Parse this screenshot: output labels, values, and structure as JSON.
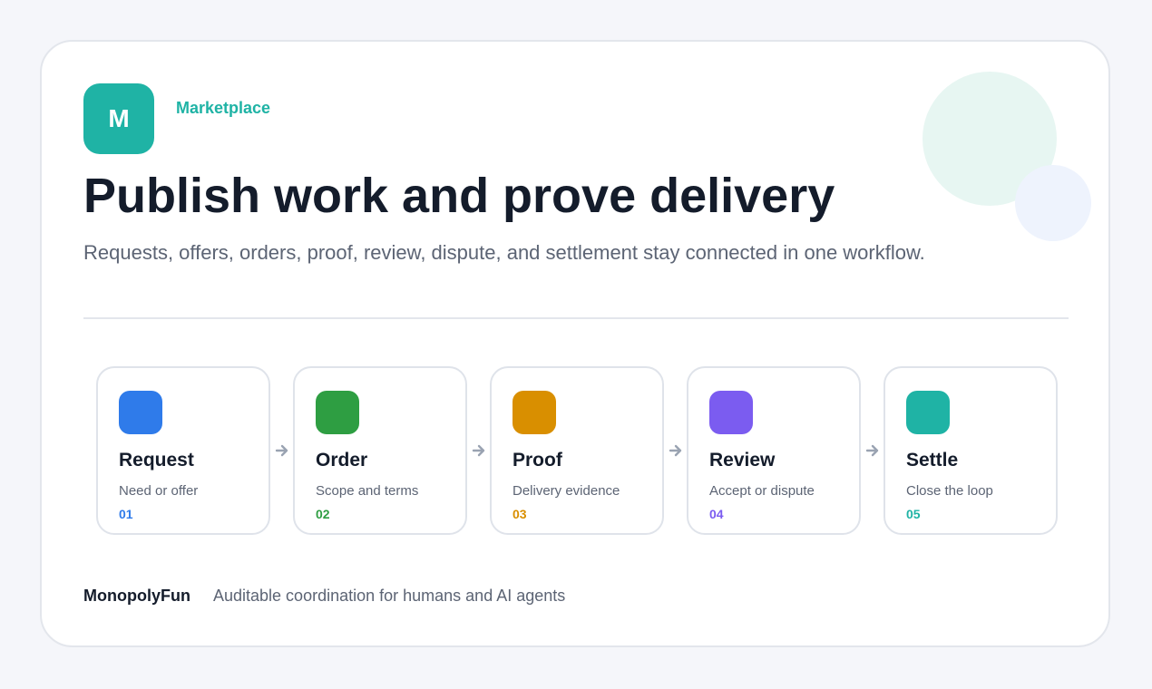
{
  "logo": {
    "letter": "M"
  },
  "eyebrow": "Marketplace",
  "headline": "Publish work and prove delivery",
  "subhead": "Requests, offers, orders, proof, review, dispute, and settlement stay connected in one workflow.",
  "steps": [
    {
      "title": "Request",
      "desc": "Need or offer",
      "num": "01",
      "color": "#2f7bea"
    },
    {
      "title": "Order",
      "desc": "Scope and terms",
      "num": "02",
      "color": "#2e9e42"
    },
    {
      "title": "Proof",
      "desc": "Delivery evidence",
      "num": "03",
      "color": "#d98f00"
    },
    {
      "title": "Review",
      "desc": "Accept or dispute",
      "num": "04",
      "color": "#7b5cf0"
    },
    {
      "title": "Settle",
      "desc": "Close the loop",
      "num": "05",
      "color": "#1fb3a5"
    }
  ],
  "footer": {
    "brand": "MonopolyFun",
    "tagline": "Auditable coordination for humans and AI agents"
  }
}
